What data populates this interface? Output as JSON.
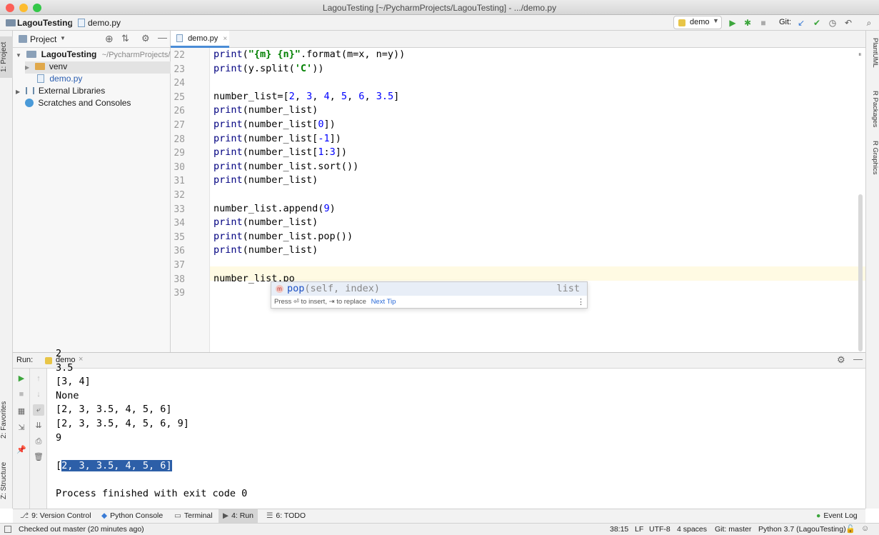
{
  "window": {
    "title": "LagouTesting [~/PycharmProjects/LagouTesting] - .../demo.py"
  },
  "navbar": {
    "project_name": "LagouTesting",
    "file_name": "demo.py",
    "run_config": "demo",
    "git_label": "Git:"
  },
  "left_stripe": {
    "project_tab": "1: Project",
    "favorites_tab": "2: Favorites",
    "structure_tab": "Z: Structure"
  },
  "right_stripe": {
    "tabs": [
      "PlantUML",
      "R Packages",
      "R Graphics"
    ]
  },
  "project_panel": {
    "title": "Project",
    "root_name": "LagouTesting",
    "root_path": "~/PycharmProjects/L",
    "venv": "venv",
    "demo_file": "demo.py",
    "external_libraries": "External Libraries",
    "scratches": "Scratches and Consoles"
  },
  "editor": {
    "tab_label": "demo.py",
    "lines": [
      {
        "no": "22",
        "text": "print(\"{m} {n}\".format(m=x, n=y))"
      },
      {
        "no": "23",
        "text": "print(y.split('C'))"
      },
      {
        "no": "24",
        "text": ""
      },
      {
        "no": "25",
        "text": "number_list=[2, 3, 4, 5, 6, 3.5]"
      },
      {
        "no": "26",
        "text": "print(number_list)"
      },
      {
        "no": "27",
        "text": "print(number_list[0])"
      },
      {
        "no": "28",
        "text": "print(number_list[-1])"
      },
      {
        "no": "29",
        "text": "print(number_list[1:3])"
      },
      {
        "no": "30",
        "text": "print(number_list.sort())"
      },
      {
        "no": "31",
        "text": "print(number_list)"
      },
      {
        "no": "32",
        "text": ""
      },
      {
        "no": "33",
        "text": "number_list.append(9)"
      },
      {
        "no": "34",
        "text": "print(number_list)"
      },
      {
        "no": "35",
        "text": "print(number_list.pop())"
      },
      {
        "no": "36",
        "text": "print(number_list)"
      },
      {
        "no": "37",
        "text": ""
      },
      {
        "no": "38",
        "text": "number_list.po"
      },
      {
        "no": "39",
        "text": ""
      }
    ]
  },
  "completion": {
    "badge": "m",
    "match": "pop",
    "signature": "(self, index)",
    "type": "list",
    "hint": "Press ⏎ to insert, ⇥ to replace",
    "next_tip": "Next Tip"
  },
  "run_panel": {
    "label": "Run:",
    "tab": "demo",
    "output": [
      "2",
      "3.5",
      "[3, 4]",
      "None",
      "[2, 3, 3.5, 4, 5, 6]",
      "[2, 3, 3.5, 4, 5, 6, 9]",
      "9"
    ],
    "last_line_prefix": "[",
    "last_line_selected": "2, 3, 3.5, 4, 5, 6]",
    "process_finished": "Process finished with exit code 0"
  },
  "bottom_tabs": {
    "version_control": "9: Version Control",
    "python_console": "Python Console",
    "terminal": "Terminal",
    "run": "4: Run",
    "todo": "6: TODO",
    "event_log": "Event Log"
  },
  "status_bar": {
    "message": "Checked out master (20 minutes ago)",
    "position": "38:15",
    "line_sep": "LF",
    "encoding": "UTF-8",
    "indent": "4 spaces",
    "git_branch": "Git: master",
    "interpreter": "Python 3.7 (LagouTesting)"
  }
}
